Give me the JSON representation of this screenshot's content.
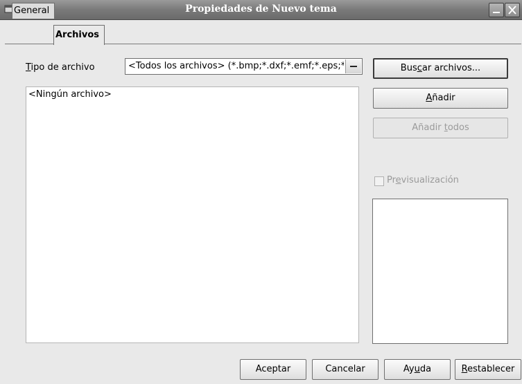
{
  "window": {
    "title": "Propiedades de Nuevo tema"
  },
  "tabs": [
    {
      "label": "General",
      "active": false
    },
    {
      "label": "Archivos",
      "active": true
    }
  ],
  "file_type": {
    "label_first": "T",
    "label_rest": "ipo de archivo",
    "value": "<Todos los archivos> (*.bmp;*.dxf;*.emf;*.eps;*.gif;*.jpg;*.jpeg;*.met;*.pbm;*.pcd;*.pct;*.pcx;*.pgm;*.png;*.ppm;*.psd;*.ras;*.sgf;*.sgv;*.svm;*.tga;*.tif;*.tiff;*.wmf;*.xbm;*.xpm)"
  },
  "file_list": {
    "empty_text": "<Ningún archivo>"
  },
  "buttons": {
    "search": {
      "pre": "Bus",
      "accel": "c",
      "post": "ar archivos..."
    },
    "add": {
      "pre": "",
      "accel": "A",
      "post": "ñadir"
    },
    "add_all": {
      "pre": "Añadir ",
      "accel": "t",
      "post": "odos"
    }
  },
  "preview": {
    "pre": "Pr",
    "accel": "e",
    "post": "visualización",
    "checked": false,
    "enabled": false
  },
  "footer": {
    "ok": "Aceptar",
    "cancel": "Cancelar",
    "help": {
      "pre": "Ay",
      "accel": "u",
      "post": "da"
    },
    "reset": {
      "pre": "",
      "accel": "R",
      "post": "establecer"
    }
  }
}
